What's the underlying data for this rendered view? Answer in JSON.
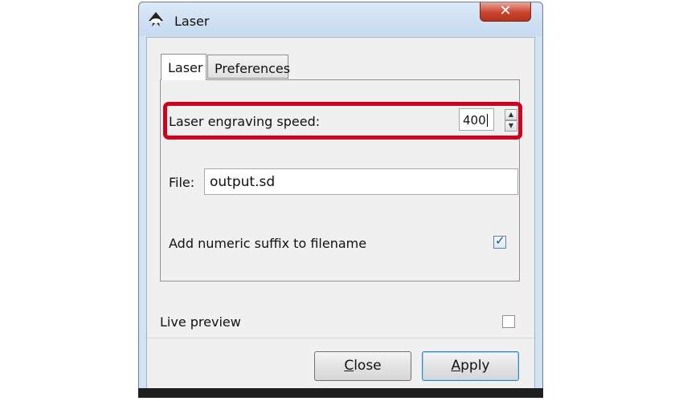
{
  "window": {
    "title": "Laser",
    "close_glyph": "✕",
    "icon": "inkscape-logo-icon"
  },
  "tabs": [
    {
      "label": "Laser",
      "active": true
    },
    {
      "label": "Preferences",
      "active": false
    }
  ],
  "laser_panel": {
    "speed_label": "Laser engraving speed:",
    "speed_value": "400",
    "file_label": "File:",
    "file_value": "output.sd",
    "suffix_label": "Add numeric suffix to filename",
    "suffix_checked": true
  },
  "live_preview": {
    "label": "Live preview",
    "checked": false
  },
  "buttons": {
    "close_mnemonic": "C",
    "close_rest": "lose",
    "apply_mnemonic": "A",
    "apply_rest": "pply"
  },
  "colors": {
    "highlight": "#d0001c",
    "title_bar": "#c7daf0",
    "close_button": "#c9442f"
  }
}
